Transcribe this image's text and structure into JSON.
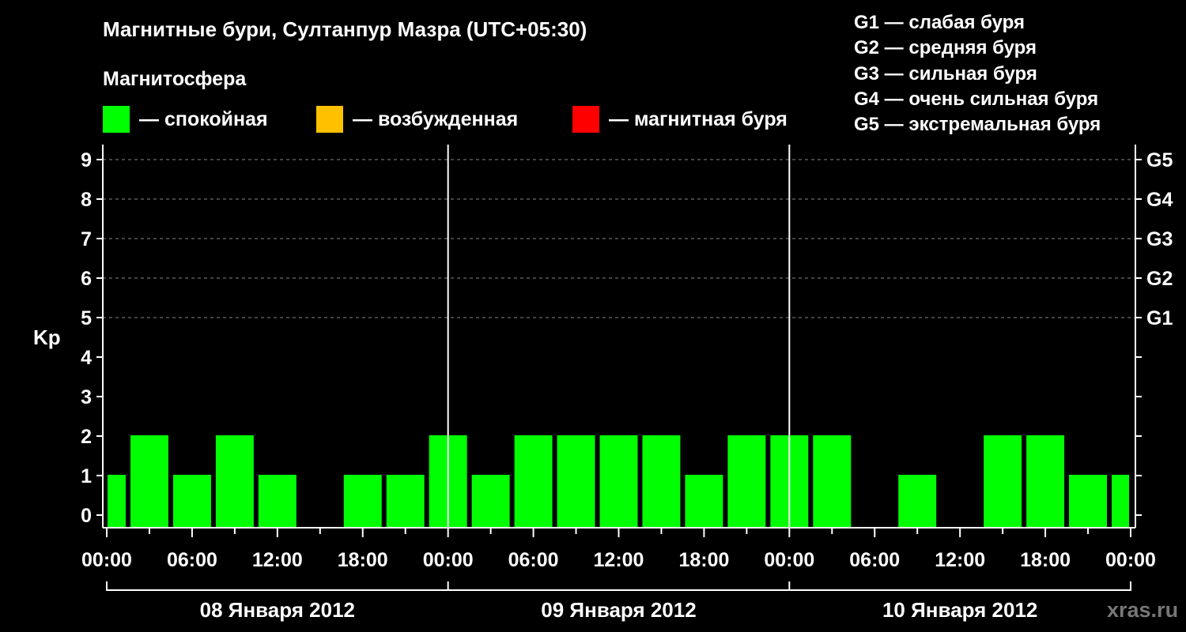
{
  "chart_data": {
    "type": "bar",
    "title": "Магнитные бури, Султанпур Мазра (UTC+05:30)",
    "subtitle": "Магнитосфера",
    "ylabel": "Kp",
    "ylim": [
      0,
      9
    ],
    "yticks": [
      "0",
      "1",
      "2",
      "3",
      "4",
      "5",
      "6",
      "7",
      "8",
      "9"
    ],
    "storm_levels": [
      {
        "kp": 5,
        "label": "G1"
      },
      {
        "kp": 6,
        "label": "G2"
      },
      {
        "kp": 7,
        "label": "G3"
      },
      {
        "kp": 8,
        "label": "G4"
      },
      {
        "kp": 9,
        "label": "G5"
      }
    ],
    "xticks": [
      "00:00",
      "06:00",
      "12:00",
      "18:00",
      "00:00",
      "06:00",
      "12:00",
      "18:00",
      "00:00",
      "06:00",
      "12:00",
      "18:00",
      "00:00"
    ],
    "days": [
      "08 Января 2012",
      "09 Января 2012",
      "10 Января 2012"
    ],
    "x_start_hour": 0,
    "x_end_hour": 72,
    "bar_interval_hours": 3,
    "bar_start_hours": [
      -1.5,
      1.5,
      4.5,
      7.5,
      10.5,
      13.5,
      16.5,
      19.5,
      22.5,
      25.5,
      28.5,
      31.5,
      34.5,
      37.5,
      40.5,
      43.5,
      46.5,
      49.5,
      52.5,
      55.5,
      58.5,
      61.5,
      64.5,
      67.5,
      70.5
    ],
    "values": [
      1,
      2,
      1,
      2,
      1,
      0,
      1,
      1,
      2,
      1,
      2,
      2,
      2,
      2,
      1,
      2,
      2,
      2,
      0,
      1,
      0,
      2,
      2,
      1,
      1
    ],
    "grid": true,
    "colors": {
      "quiet": "#00ff00",
      "disturbed": "#ffc000",
      "storm": "#ff0000"
    }
  },
  "legend": [
    {
      "label": "— спокойная",
      "color": "#00ff00"
    },
    {
      "label": "— возбужденная",
      "color": "#ffc000"
    },
    {
      "label": "— магнитная буря",
      "color": "#ff0000"
    }
  ],
  "g_legend": [
    "G1 — слабая буря",
    "G2 — средняя буря",
    "G3 — сильная буря",
    "G4 — очень сильная буря",
    "G5 — экстремальная буря"
  ],
  "watermark": "xras.ru"
}
